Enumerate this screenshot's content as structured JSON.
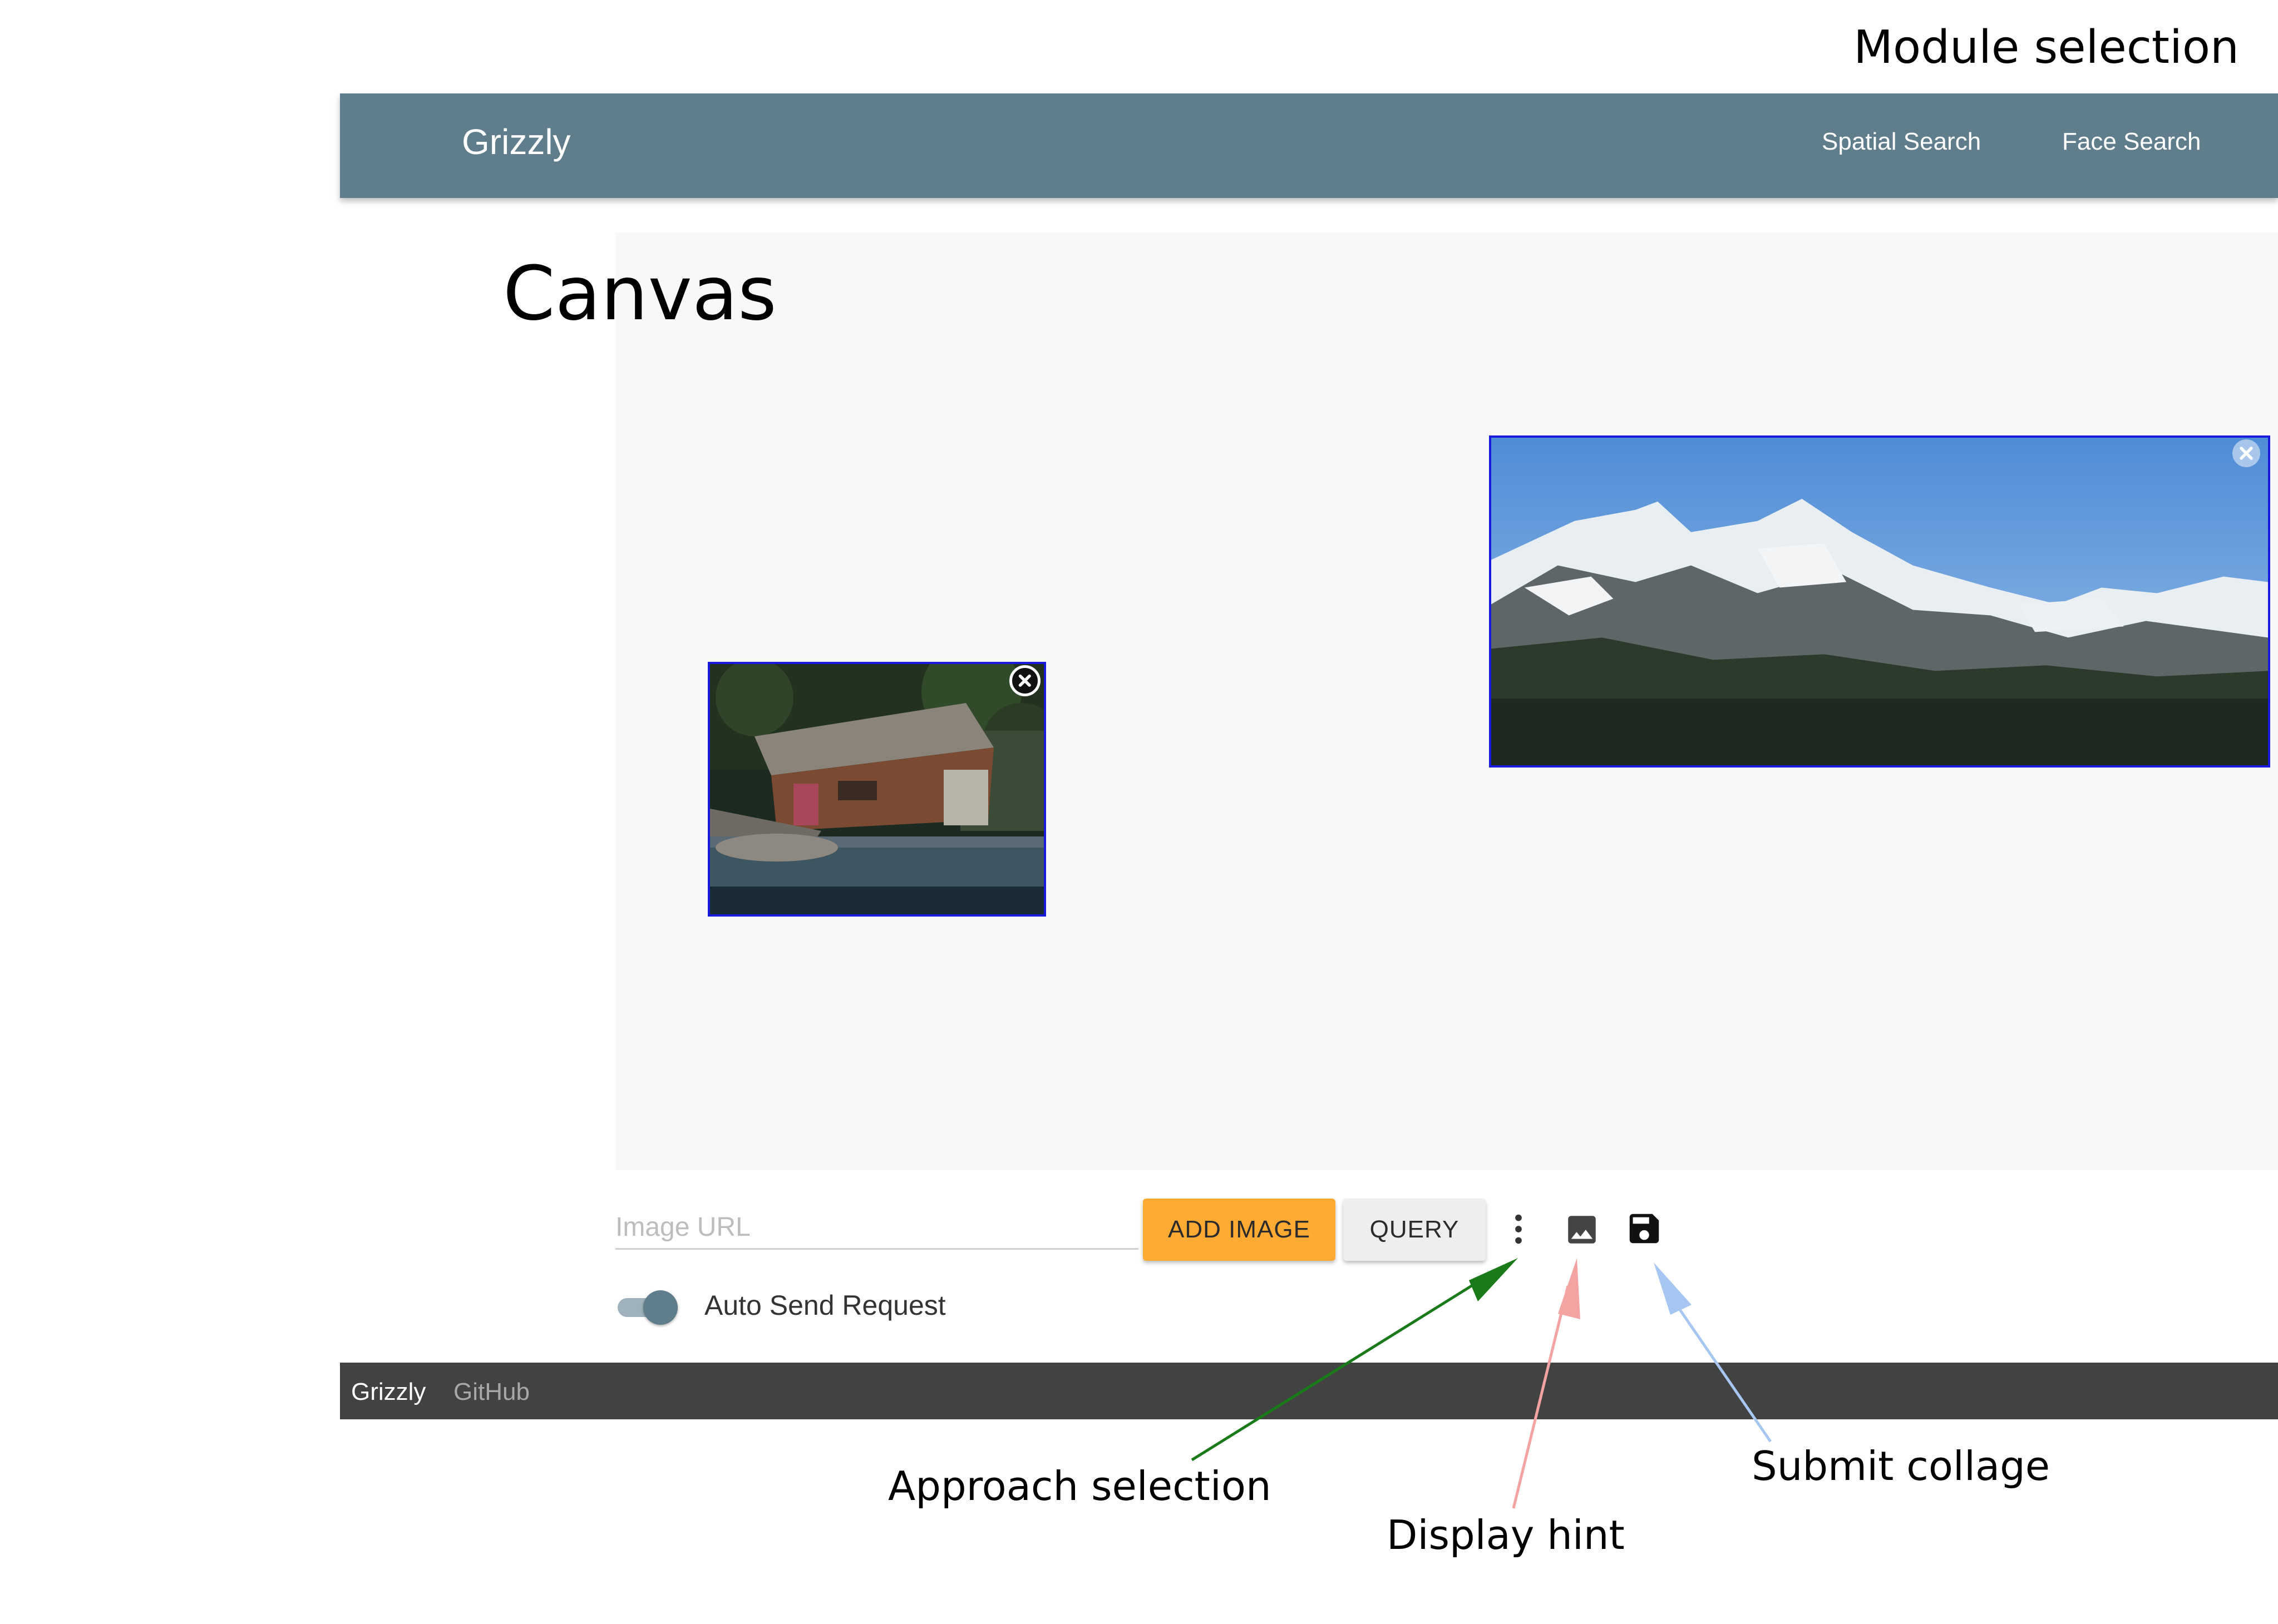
{
  "annotations": {
    "module_selection": "Module selection",
    "canvas": "Canvas",
    "approach_selection": "Approach selection",
    "display_hint": "Display hint",
    "submit_collage": "Submit collage"
  },
  "navbar": {
    "brand": "Grizzly",
    "links": [
      "Spatial Search",
      "Face Search"
    ],
    "color": "#607d8b"
  },
  "canvas": {
    "tiles": [
      {
        "subject": "cabin-by-lake",
        "close_icon": "close-circle-icon"
      },
      {
        "subject": "snowy-mountains",
        "close_icon": "close-icon"
      }
    ]
  },
  "toolbar": {
    "url_placeholder": "Image URL",
    "add_image_label": "ADD IMAGE",
    "query_label": "QUERY",
    "icons": [
      "more-vertical-icon",
      "image-icon",
      "save-icon"
    ],
    "add_image_color": "#ffaa33"
  },
  "auto_send": {
    "label": "Auto Send Request",
    "enabled": true
  },
  "footer": {
    "brand": "Grizzly",
    "link": "GitHub"
  },
  "arrow_colors": {
    "approach": "#1a7a1a",
    "display": "#f4a3a3",
    "submit": "#a7c7f2"
  }
}
